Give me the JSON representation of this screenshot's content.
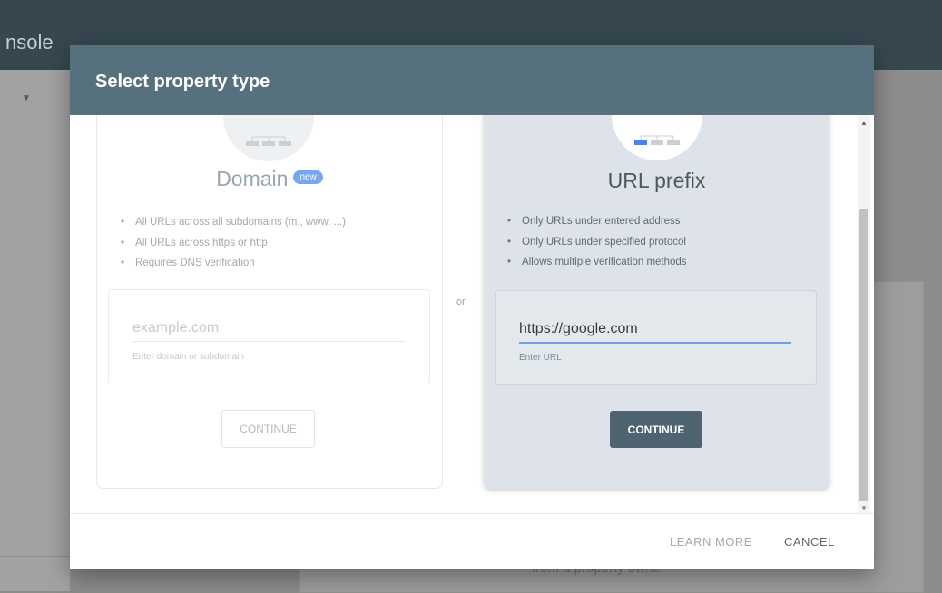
{
  "app": {
    "title_fragment": "nsole"
  },
  "background": {
    "text_fragment": "from a property owner"
  },
  "dialog": {
    "title": "Select property type",
    "separator": "or",
    "domain_card": {
      "title": "Domain",
      "badge": "new",
      "features": [
        "All URLs across all subdomains (m., www. ...)",
        "All URLs across https or http",
        "Requires DNS verification"
      ],
      "input_value": "",
      "input_placeholder": "example.com",
      "input_caption": "Enter domain or subdomain",
      "button_label": "CONTINUE",
      "icon": "network-icon"
    },
    "url_card": {
      "title": "URL prefix",
      "features": [
        "Only URLs under entered address",
        "Only URLs under specified protocol",
        "Allows multiple verification methods"
      ],
      "input_value": "https://google.com",
      "input_placeholder": "",
      "input_caption": "Enter URL",
      "button_label": "CONTINUE",
      "icon": "network-icon"
    },
    "footer": {
      "learn_more": "LEARN MORE",
      "cancel": "CANCEL"
    }
  },
  "colors": {
    "header": "#57707d",
    "topbar": "#37474f",
    "primary_button": "#4f6470",
    "badge": "#78a6f0",
    "input_underline_active": "#6e9ee6"
  }
}
